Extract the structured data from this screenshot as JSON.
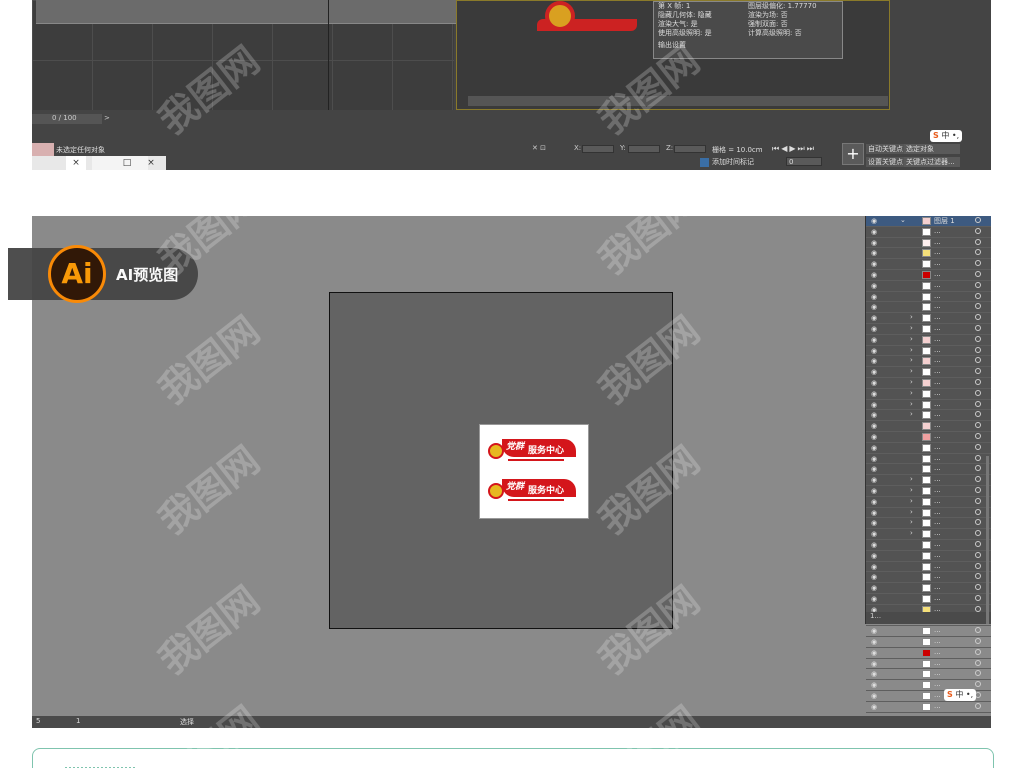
{
  "max": {
    "info_rows": [
      [
        "第 X 帧: 1",
        "图层级偏化: 1.77770"
      ],
      [
        "隐藏几何体: 隐藏",
        "渲染为场: 否"
      ],
      [
        "渲染大气: 是",
        "强制双面: 否"
      ],
      [
        "使用高级照明: 是",
        "计算高级照明: 否"
      ]
    ],
    "render_output": "输出设置",
    "frame_counter": "0 / 100",
    "status_text": "未选定任何对象",
    "coord_x_label": "X:",
    "coord_y_label": "Y:",
    "coord_z_label": "Z:",
    "grid_text": "栅格 = 10.0cm",
    "add_time_tag": "添加时间标记",
    "auto_key": "自动关键点",
    "set_key": "设置关键点",
    "selected_object": "选定对象",
    "key_filter": "关键点过滤器...",
    "frame_value": "0",
    "tabs": [
      "×",
      "□",
      "×"
    ],
    "ime": {
      "brand": "S",
      "text": "中 •,"
    }
  },
  "badge": {
    "logo": "Ai",
    "label": "AI预览图"
  },
  "ai": {
    "layer_head": "图层 1",
    "layer_dots": "...",
    "layers_footer": "1...",
    "status_zoom": "5",
    "status_page": "1",
    "status_tool": "选择",
    "art_top_text": "服务中心",
    "art_top_script": "党群",
    "ime": {
      "brand": "S",
      "text": "中 •,"
    }
  },
  "layer_thumbs": [
    "#fff",
    "#fff0f0",
    "#f5e07a",
    "#ffffff",
    "#cc0000",
    "#ffffff",
    "#ffffff",
    "#ffffff",
    "#ffffff",
    "#ffffff",
    "#f4d0d0",
    "#ffffff",
    "#f4d0d0",
    "#ffffff",
    "#f4d0d0",
    "#ffffff",
    "#ffffff",
    "#ffffff",
    "#f4d0d0",
    "#f0a0a0",
    "#ffffff",
    "#ffffff",
    "#ffffff",
    "#ffffff",
    "#ffffff",
    "#ffffff",
    "#ffffff",
    "#ffffff",
    "#ffffff",
    "#ffffff",
    "#ffffff",
    "#ffffff",
    "#ffffff",
    "#ffffff",
    "#ffffff",
    "#f5e07a",
    "#ffffff",
    "#ffffff",
    "#ffffff",
    "#cc0000",
    "#ffffff",
    "#ffffff",
    "#ffffff",
    "#ffffff",
    "#ffffff"
  ],
  "layer_arrows": [
    false,
    false,
    false,
    false,
    false,
    false,
    false,
    false,
    true,
    true,
    true,
    true,
    true,
    true,
    true,
    true,
    true,
    true,
    false,
    false,
    false,
    false,
    false,
    true,
    true,
    true,
    true,
    true,
    true,
    false,
    false,
    false,
    false,
    false,
    false,
    false,
    false,
    false,
    false,
    false,
    false,
    false,
    false,
    false,
    false
  ],
  "watermark": "我图网"
}
